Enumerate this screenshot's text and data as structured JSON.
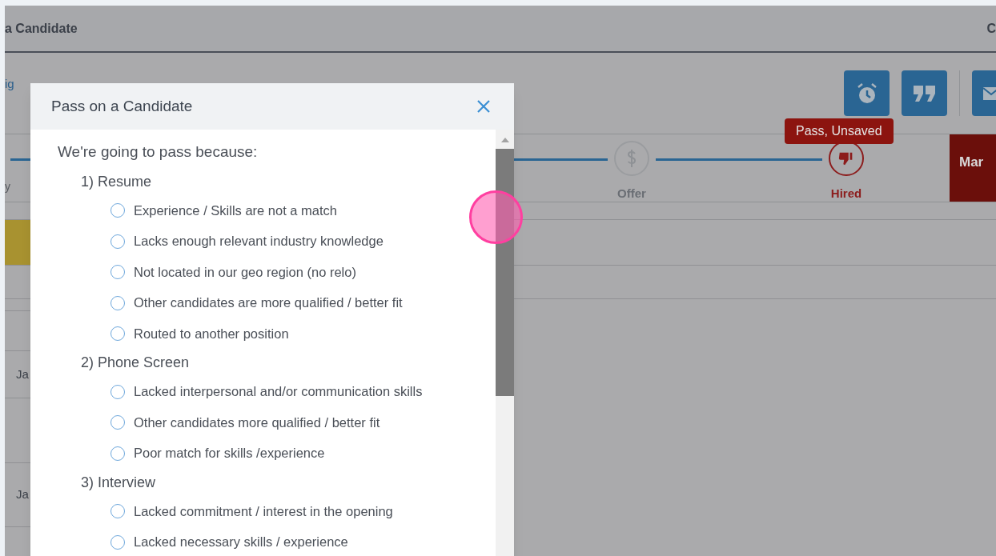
{
  "background_page": {
    "title": "a Candidate",
    "title_right": "C",
    "link": "ig",
    "stepper": {
      "left_label": "y",
      "steps": [
        {
          "label": "Offer",
          "kind": "inactive"
        },
        {
          "label": "Hired",
          "kind": "passed"
        }
      ],
      "tooltip": "Pass, Unsaved",
      "action_label": "Mar"
    },
    "rows": [
      "Ja",
      "Ja"
    ]
  },
  "modal": {
    "title": "Pass on a Candidate",
    "prompt": "We're going to pass because:",
    "sections": [
      {
        "title": "1) Resume",
        "options": [
          {
            "label": "Experience / Skills are not a match",
            "selected": false
          },
          {
            "label": "Lacks enough relevant industry knowledge",
            "selected": false
          },
          {
            "label": "Not located in our geo region (no relo)",
            "selected": false
          },
          {
            "label": "Other candidates are more qualified / better fit",
            "selected": false
          },
          {
            "label": "Routed to another position",
            "selected": false
          }
        ]
      },
      {
        "title": "2) Phone Screen",
        "options": [
          {
            "label": "Lacked interpersonal and/or communication skills",
            "selected": false
          },
          {
            "label": "Other candidates more qualified / better fit",
            "selected": false
          },
          {
            "label": "Poor match for skills /experience",
            "selected": false
          }
        ]
      },
      {
        "title": "3) Interview",
        "options": [
          {
            "label": "Lacked commitment / interest in the opening",
            "selected": false
          },
          {
            "label": "Lacked necessary skills / experience",
            "selected": false
          }
        ]
      }
    ]
  }
}
